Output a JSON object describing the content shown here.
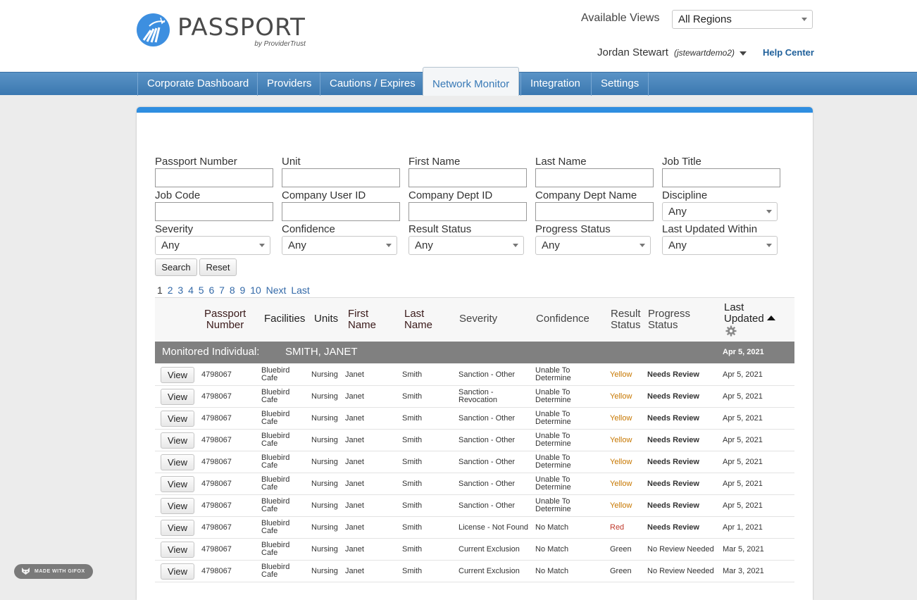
{
  "header": {
    "logo_word": "PASSPORT",
    "logo_sub": "by ProviderTrust",
    "views_label": "Available Views",
    "views_value": "All Regions",
    "user_name": "Jordan Stewart",
    "user_handle": "(jstewartdemo2)",
    "help_label": "Help Center"
  },
  "nav": {
    "items": [
      "Corporate Dashboard",
      "Providers",
      "Cautions / Expires",
      "Network Monitor",
      "Integration",
      "Settings"
    ],
    "active": "Network Monitor"
  },
  "filters": {
    "labels": {
      "passport_number": "Passport Number",
      "unit": "Unit",
      "first_name": "First Name",
      "last_name": "Last Name",
      "job_title": "Job Title",
      "job_code": "Job Code",
      "company_user_id": "Company User ID",
      "company_dept_id": "Company Dept ID",
      "company_dept_name": "Company Dept Name",
      "discipline": "Discipline",
      "severity": "Severity",
      "confidence": "Confidence",
      "result_status": "Result Status",
      "progress_status": "Progress Status",
      "last_updated_within": "Last Updated Within"
    },
    "values": {
      "discipline": "Any",
      "severity": "Any",
      "confidence": "Any",
      "result_status": "Any",
      "progress_status": "Any",
      "last_updated_within": "Any"
    },
    "search_label": "Search",
    "reset_label": "Reset"
  },
  "pager": {
    "current": "1",
    "pages": [
      "2",
      "3",
      "4",
      "5",
      "6",
      "7",
      "8",
      "9",
      "10"
    ],
    "next": "Next",
    "last": "Last"
  },
  "table": {
    "headers": {
      "passport_number": [
        "Passport",
        "Number"
      ],
      "facilities": "Facilities",
      "units": "Units",
      "first_name": [
        "First",
        "Name"
      ],
      "last_name": [
        "Last",
        "Name"
      ],
      "severity": "Severity",
      "confidence": "Confidence",
      "result_status": [
        "Result",
        "Status"
      ],
      "progress_status": [
        "Progress",
        "Status"
      ],
      "last_updated": [
        "Last",
        "Updated"
      ]
    },
    "group": {
      "label": "Monitored Individual:",
      "name": "SMITH, JANET",
      "date": "Apr 5, 2021"
    },
    "view_label": "View",
    "rows": [
      {
        "passport": "4798067",
        "facility": [
          "Bluebird",
          "Cafe"
        ],
        "unit": "Nursing",
        "first": "Janet",
        "last": "Smith",
        "severity": [
          "Sanction - Other"
        ],
        "confidence": [
          "Unable To",
          "Determine"
        ],
        "result": "Yellow",
        "result_color": "#c77700",
        "progress": "Needs Review",
        "progress_bold": true,
        "updated": "Apr 5, 2021"
      },
      {
        "passport": "4798067",
        "facility": [
          "Bluebird",
          "Cafe"
        ],
        "unit": "Nursing",
        "first": "Janet",
        "last": "Smith",
        "severity": [
          "Sanction -",
          "Revocation"
        ],
        "confidence": [
          "Unable To",
          "Determine"
        ],
        "result": "Yellow",
        "result_color": "#c77700",
        "progress": "Needs Review",
        "progress_bold": true,
        "updated": "Apr 5, 2021"
      },
      {
        "passport": "4798067",
        "facility": [
          "Bluebird",
          "Cafe"
        ],
        "unit": "Nursing",
        "first": "Janet",
        "last": "Smith",
        "severity": [
          "Sanction - Other"
        ],
        "confidence": [
          "Unable To",
          "Determine"
        ],
        "result": "Yellow",
        "result_color": "#c77700",
        "progress": "Needs Review",
        "progress_bold": true,
        "updated": "Apr 5, 2021"
      },
      {
        "passport": "4798067",
        "facility": [
          "Bluebird",
          "Cafe"
        ],
        "unit": "Nursing",
        "first": "Janet",
        "last": "Smith",
        "severity": [
          "Sanction - Other"
        ],
        "confidence": [
          "Unable To",
          "Determine"
        ],
        "result": "Yellow",
        "result_color": "#c77700",
        "progress": "Needs Review",
        "progress_bold": true,
        "updated": "Apr 5, 2021"
      },
      {
        "passport": "4798067",
        "facility": [
          "Bluebird",
          "Cafe"
        ],
        "unit": "Nursing",
        "first": "Janet",
        "last": "Smith",
        "severity": [
          "Sanction - Other"
        ],
        "confidence": [
          "Unable To",
          "Determine"
        ],
        "result": "Yellow",
        "result_color": "#c77700",
        "progress": "Needs Review",
        "progress_bold": true,
        "updated": "Apr 5, 2021"
      },
      {
        "passport": "4798067",
        "facility": [
          "Bluebird",
          "Cafe"
        ],
        "unit": "Nursing",
        "first": "Janet",
        "last": "Smith",
        "severity": [
          "Sanction - Other"
        ],
        "confidence": [
          "Unable To",
          "Determine"
        ],
        "result": "Yellow",
        "result_color": "#c77700",
        "progress": "Needs Review",
        "progress_bold": true,
        "updated": "Apr 5, 2021"
      },
      {
        "passport": "4798067",
        "facility": [
          "Bluebird",
          "Cafe"
        ],
        "unit": "Nursing",
        "first": "Janet",
        "last": "Smith",
        "severity": [
          "Sanction - Other"
        ],
        "confidence": [
          "Unable To",
          "Determine"
        ],
        "result": "Yellow",
        "result_color": "#c77700",
        "progress": "Needs Review",
        "progress_bold": true,
        "updated": "Apr 5, 2021"
      },
      {
        "passport": "4798067",
        "facility": [
          "Bluebird",
          "Cafe"
        ],
        "unit": "Nursing",
        "first": "Janet",
        "last": "Smith",
        "severity": [
          "License - Not Found"
        ],
        "confidence": [
          "No Match"
        ],
        "result": "Red",
        "result_color": "#c0392b",
        "progress": "Needs Review",
        "progress_bold": true,
        "updated": "Apr 1, 2021"
      },
      {
        "passport": "4798067",
        "facility": [
          "Bluebird",
          "Cafe"
        ],
        "unit": "Nursing",
        "first": "Janet",
        "last": "Smith",
        "severity": [
          "Current Exclusion"
        ],
        "confidence": [
          "No Match"
        ],
        "result": "Green",
        "result_color": "#333333",
        "progress": "No Review Needed",
        "progress_bold": false,
        "updated": "Mar 5, 2021"
      },
      {
        "passport": "4798067",
        "facility": [
          "Bluebird",
          "Cafe"
        ],
        "unit": "Nursing",
        "first": "Janet",
        "last": "Smith",
        "severity": [
          "Current Exclusion"
        ],
        "confidence": [
          "No Match"
        ],
        "result": "Green",
        "result_color": "#333333",
        "progress": "No Review Needed",
        "progress_bold": false,
        "updated": "Mar 3, 2021"
      }
    ]
  },
  "badge": {
    "label": "MADE WITH GIFOX"
  },
  "colors": {
    "accent": "#2f8ee0",
    "nav": "#4a86bc",
    "link": "#1e5f9a"
  }
}
